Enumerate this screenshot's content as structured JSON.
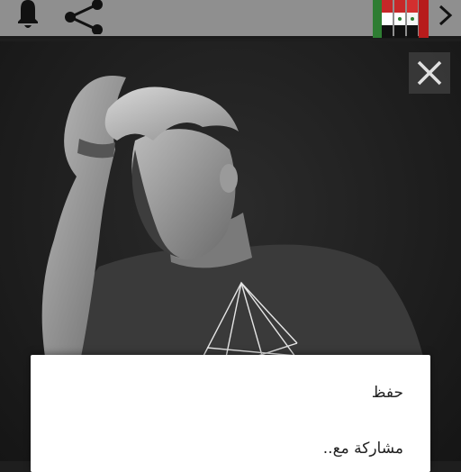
{
  "topbar": {
    "left_icons": [
      "bell-icon",
      "share-icon"
    ],
    "right_icons": [
      "flags-icon",
      "chevron-right-icon"
    ],
    "background": "#8f8f8f"
  },
  "viewer": {
    "close_icon": "close-icon",
    "background": "#1e1e1e"
  },
  "context_menu": {
    "items": [
      {
        "label": "حفظ"
      },
      {
        "label": "مشاركة مع.."
      }
    ]
  }
}
